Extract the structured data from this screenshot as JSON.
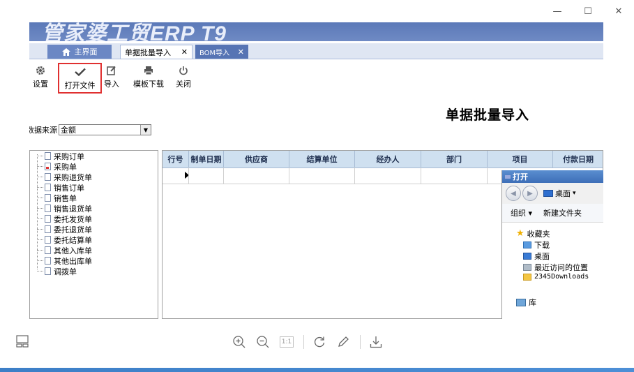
{
  "window": {
    "minimize": "—",
    "maximize": "☐",
    "close": "✕"
  },
  "app": {
    "banner_title": "管家婆工贸ERP T9"
  },
  "tabs": [
    {
      "label": "主界面",
      "icon": "home-icon"
    },
    {
      "label": "单据批量导入",
      "close": "✕"
    },
    {
      "label": "BOM导入",
      "close": "✕"
    }
  ],
  "toolbar": {
    "settings": {
      "label": "设置",
      "icon": "gear-icon"
    },
    "open_file": {
      "label": "打开文件",
      "icon": "checkmark-icon"
    },
    "import": {
      "label": "导入",
      "icon": "edit-icon"
    },
    "template_download": {
      "label": "模板下载",
      "icon": "printer-icon"
    },
    "close": {
      "label": "关闭",
      "icon": "power-icon"
    }
  },
  "page": {
    "title": "单据批量导入",
    "source_label": "数据来源",
    "source_value": "金额"
  },
  "tree_items": [
    "采购订单",
    "采购单",
    "采购退货单",
    "销售订单",
    "销售单",
    "销售退货单",
    "委托发货单",
    "委托退货单",
    "委托结算单",
    "其他入库单",
    "其他出库单",
    "调拨单"
  ],
  "grid_columns": [
    "行号",
    "制单日期",
    "供应商",
    "结算单位",
    "经办人",
    "部门",
    "项目",
    "付款日期"
  ],
  "open_dialog": {
    "title": "打开",
    "location": "桌面",
    "organize": "组织 ▾",
    "new_folder": "新建文件夹",
    "favorites": "收藏夹",
    "items": [
      "下载",
      "桌面",
      "最近访问的位置",
      "2345Downloads"
    ],
    "library": "库"
  },
  "viewer": {
    "zoom_in": "zoom-in-icon",
    "zoom_out": "zoom-out-icon",
    "actual_size": "1:1",
    "rotate": "rotate-icon",
    "edit": "pencil-icon",
    "download": "download-icon"
  },
  "colors": {
    "banner": "#6f8ac4",
    "tab_active_bg": "#ffffff",
    "grid_header": "#cfe0f0",
    "highlight": "#e03030"
  }
}
